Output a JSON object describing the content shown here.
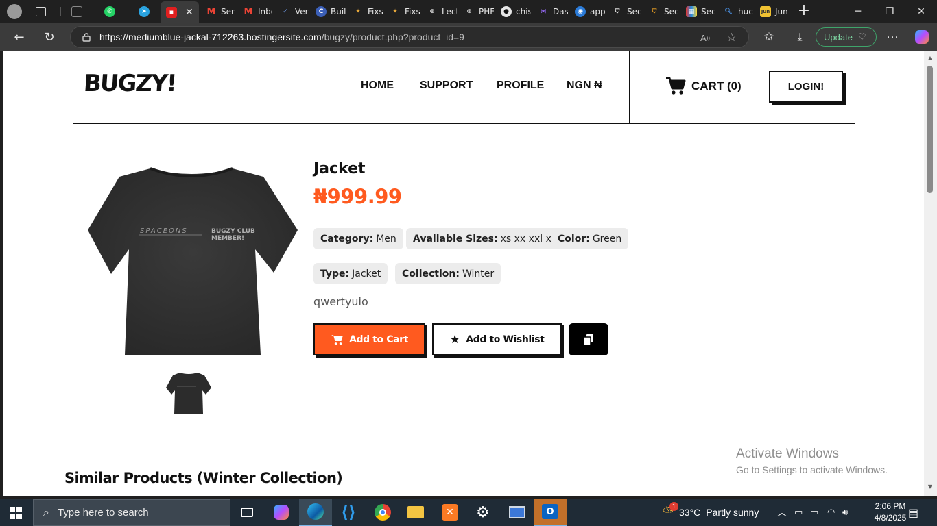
{
  "browser": {
    "tabs": [
      {
        "label": "",
        "icon": "edge-sidebar-icon"
      },
      {
        "label": "",
        "icon": "whatsapp-icon"
      },
      {
        "label": "",
        "icon": "telegram-icon"
      },
      {
        "label": "",
        "icon": "active-site-icon"
      },
      {
        "label": "Sen",
        "icon": "gmail-icon"
      },
      {
        "label": "Inbo",
        "icon": "gmail-icon"
      },
      {
        "label": "Verc",
        "icon": "vercel-icon"
      },
      {
        "label": "Buil",
        "icon": "build-icon"
      },
      {
        "label": "Fixs",
        "icon": "fixs-icon"
      },
      {
        "label": "Fixs",
        "icon": "fixs-icon"
      },
      {
        "label": "Lect",
        "icon": "openai-icon"
      },
      {
        "label": "PHF",
        "icon": "openai-icon"
      },
      {
        "label": "chis",
        "icon": "github-icon"
      },
      {
        "label": "Das",
        "icon": "dashboard-icon"
      },
      {
        "label": "app",
        "icon": "app-icon"
      },
      {
        "label": "Sec",
        "icon": "shield-icon"
      },
      {
        "label": "Sec",
        "icon": "shield-icon"
      },
      {
        "label": "Sec",
        "icon": "security-icon"
      },
      {
        "label": "huc",
        "icon": "search-icon"
      },
      {
        "label": "Jun",
        "icon": "jun-icon"
      }
    ],
    "url_host": "https://mediumblue-jackal-712263.hostingersite.com",
    "url_path": "/bugzy/product.php?product_id=9",
    "update_label": "Update"
  },
  "site": {
    "logo": "BUGZY!",
    "nav": {
      "home": "HOME",
      "support": "SUPPORT",
      "profile": "PROFILE",
      "currency": "NGN ₦"
    },
    "cart_label": "CART (0)",
    "login_label": "LOGIN!"
  },
  "product": {
    "title": "Jacket",
    "price": "₦999.99",
    "attributes": [
      {
        "key": "Category:",
        "value": "Men"
      },
      {
        "key": "Available Sizes:",
        "value": "xs xx xxl xl"
      },
      {
        "key": "Color:",
        "value": "Green"
      },
      {
        "key": "Type:",
        "value": "Jacket"
      },
      {
        "key": "Collection:",
        "value": "Winter"
      }
    ],
    "description": "qwertyuio",
    "add_to_cart": "Add to Cart",
    "add_to_wishlist": "Add to Wishlist",
    "shirt_print_left": "SPACEONS",
    "shirt_print_right_1": "BUGZY CLUB",
    "shirt_print_right_2": "MEMBER!"
  },
  "similar_heading": "Similar Products (Winter Collection)",
  "watermark": {
    "line1": "Activate Windows",
    "line2": "Go to Settings to activate Windows."
  },
  "taskbar": {
    "search_placeholder": "Type here to search",
    "weather_temp": "33°C",
    "weather_desc": "Partly sunny",
    "weather_badge": "1",
    "time": "2:06 PM",
    "date": "4/8/2025"
  },
  "colors": {
    "accent": "#ff5a1f",
    "chip_bg": "#ececec",
    "browser_dark": "#202020"
  }
}
